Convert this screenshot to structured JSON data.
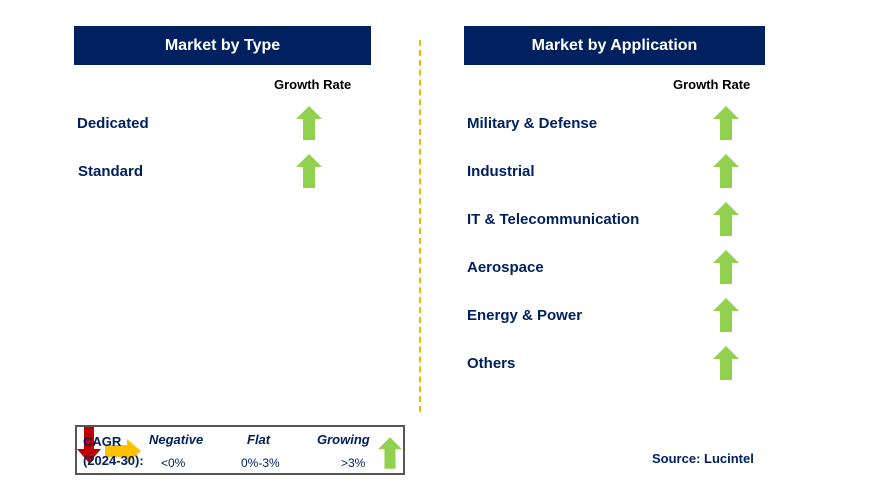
{
  "type_panel": {
    "title": "Market by Type",
    "growth_header": "Growth Rate",
    "items": [
      {
        "label": "Dedicated",
        "trend": "growing"
      },
      {
        "label": "Standard",
        "trend": "growing"
      }
    ]
  },
  "application_panel": {
    "title": "Market by Application",
    "growth_header": "Growth Rate",
    "items": [
      {
        "label": "Military & Defense",
        "trend": "growing"
      },
      {
        "label": "Industrial",
        "trend": "growing"
      },
      {
        "label": "IT & Telecommunication",
        "trend": "growing"
      },
      {
        "label": "Aerospace",
        "trend": "growing"
      },
      {
        "label": "Energy & Power",
        "trend": "growing"
      },
      {
        "label": "Others",
        "trend": "growing"
      }
    ]
  },
  "legend": {
    "cagr": "CAGR",
    "period": "(2024-30):",
    "negative": "Negative",
    "negative_range": "<0%",
    "flat": "Flat",
    "flat_range": "0%-3%",
    "growing": "Growing",
    "growing_range": ">3%"
  },
  "source": "Source: Lucintel",
  "colors": {
    "header": "#002060",
    "growing": "#92d050",
    "negative": "#c00000",
    "flat": "#ffc000",
    "divider": "#f5b800"
  }
}
